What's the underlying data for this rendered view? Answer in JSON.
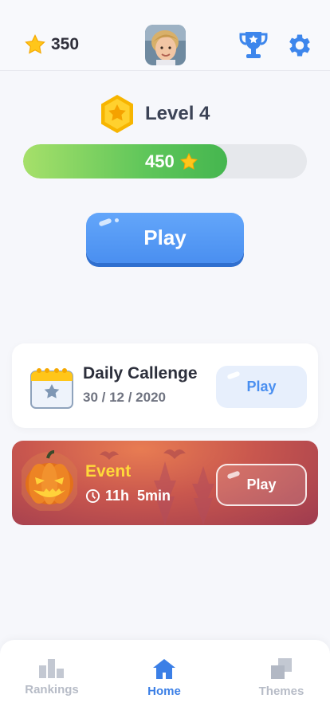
{
  "header": {
    "coins": "350",
    "icons": [
      "star-icon",
      "avatar",
      "trophy-icon",
      "gear-icon"
    ]
  },
  "level": {
    "label": "Level 4",
    "progress_text": "450",
    "progress_fraction": 0.72
  },
  "main": {
    "play_label": "Play"
  },
  "daily": {
    "title": "Daily Callenge",
    "date": "30 / 12 / 2020",
    "play_label": "Play"
  },
  "event": {
    "title": "Event",
    "timer": "11h  5min",
    "play_label": "Play"
  },
  "tabs": [
    {
      "label": "Rankings",
      "icon": "bar-chart-icon"
    },
    {
      "label": "Home",
      "icon": "home-icon"
    },
    {
      "label": "Themes",
      "icon": "squares-icon"
    }
  ],
  "colors": {
    "accent": "#4a8ff0",
    "gold": "#ffc61a",
    "progress_green": "#5fc65a",
    "event_title": "#ffd93a",
    "inactive": "#b7bcc7"
  }
}
